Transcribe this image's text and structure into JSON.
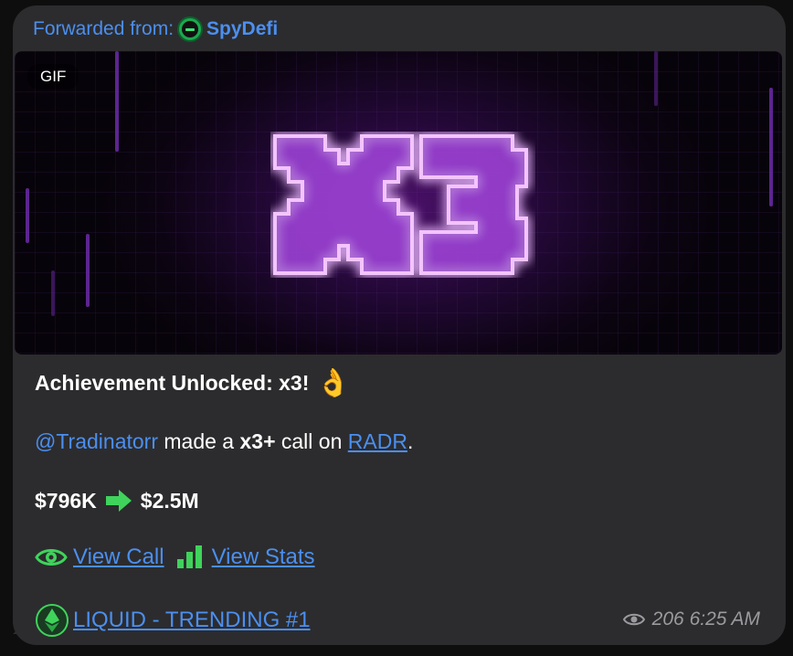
{
  "forward": {
    "prefix": "Forwarded from:",
    "channel": "SpyDefi"
  },
  "media": {
    "badge": "GIF",
    "glow_text": "x3",
    "glow_color": "#d98bff"
  },
  "message": {
    "title": "Achievement Unlocked: x3!",
    "title_emoji": "👌",
    "mention": "@Tradinatorr",
    "made_a": "made a",
    "multiplier": "x3+",
    "call_on": "call on",
    "token": "RADR",
    "period": ".",
    "price_from": "$796K",
    "price_to": "$2.5M",
    "view_call": "View Call",
    "view_stats": "View Stats",
    "trending": "LIQUID - TRENDING #1"
  },
  "meta": {
    "views": "206",
    "time": "6:25 AM"
  },
  "colors": {
    "bubble": "#2c2c2e",
    "link": "#4b8ff0",
    "green": "#3fd35b",
    "meta": "#9a9a9f"
  },
  "icons": [
    "eye-icon",
    "bar-chart-icon",
    "arrow-right-icon",
    "ethereum-icon",
    "ok-hand-emoji"
  ]
}
